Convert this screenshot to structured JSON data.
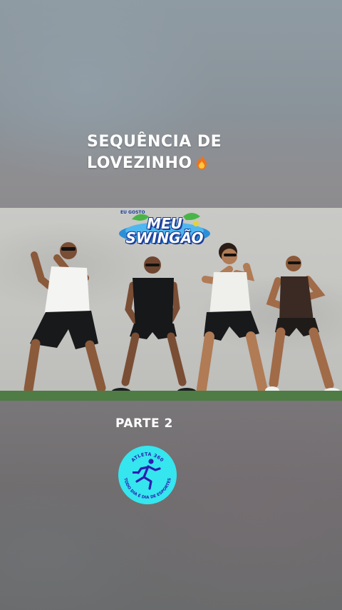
{
  "caption": {
    "line1": "SEQUÊNCIA DE",
    "line2": "LOVEZINHO",
    "emoji_icon": "fire-icon"
  },
  "video": {
    "logo": {
      "small_text": "EU GOSTO",
      "line1": "MEU",
      "line2": "SWINGÃO"
    }
  },
  "subtitle": "PARTE 2",
  "badge": {
    "top_text": "ATLETA 360",
    "bottom_text": "TODO DIA É DIA DE ESPORTES",
    "icon": "runner-icon"
  },
  "colors": {
    "badge_bg": "#35e6ee",
    "badge_text": "#2b1fb0",
    "logo_blue": "#1b3f9a",
    "logo_green": "#49b548"
  }
}
